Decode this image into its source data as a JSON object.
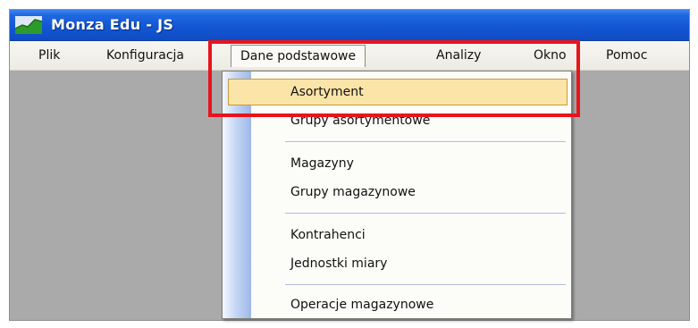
{
  "window": {
    "title": "Monza Edu - JS",
    "icon": "chart-area-icon"
  },
  "menubar": {
    "items": [
      {
        "label": "Plik"
      },
      {
        "label": "Konfiguracja"
      },
      {
        "label": "Dane podstawowe",
        "active": true
      },
      {
        "label": "Analizy"
      },
      {
        "label": "Okno"
      },
      {
        "label": "Pomoc"
      }
    ]
  },
  "dropdown": {
    "items": [
      {
        "label": "Asortyment",
        "highlighted": true
      },
      {
        "label": "Grupy asortymentowe"
      },
      {
        "label": "Magazyny"
      },
      {
        "label": "Grupy magazynowe"
      },
      {
        "label": "Kontrahenci"
      },
      {
        "label": "Jednostki miary"
      },
      {
        "label": "Operacje magazynowe"
      }
    ]
  },
  "colors": {
    "titlebar": "#1356d3",
    "menubar": "#ecebe3",
    "highlight": "#fbe4a7",
    "callout": "#e8141c",
    "workspace": "#aaaaaa"
  }
}
